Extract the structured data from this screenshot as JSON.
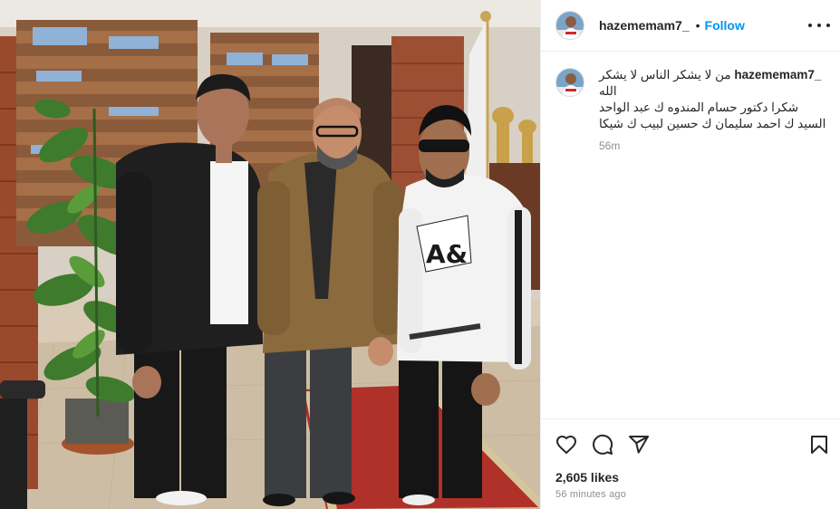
{
  "post": {
    "image_alt": "Three men posing in an office",
    "username": "hazememam7_",
    "follow_label": "Follow",
    "separator": "•",
    "caption_user": "hazememam7_",
    "caption_text": "من لا يشكر الناس لا يشكر الله\nشكرا دكتور حسام المندوه ك عبد الواحد السيد ك احمد سليمان ك حسين لبيب ك شيكا",
    "caption_age": "56m",
    "likes_label": "2,605 likes",
    "time_ago": "56 minutes ago"
  },
  "icons": {
    "more": "more-options-icon",
    "like": "heart-icon",
    "comment": "comment-icon",
    "share": "share-icon",
    "save": "bookmark-icon"
  },
  "colors": {
    "follow": "#0095f6",
    "text": "#262626",
    "muted": "#8e8e8e",
    "border": "#efefef"
  }
}
